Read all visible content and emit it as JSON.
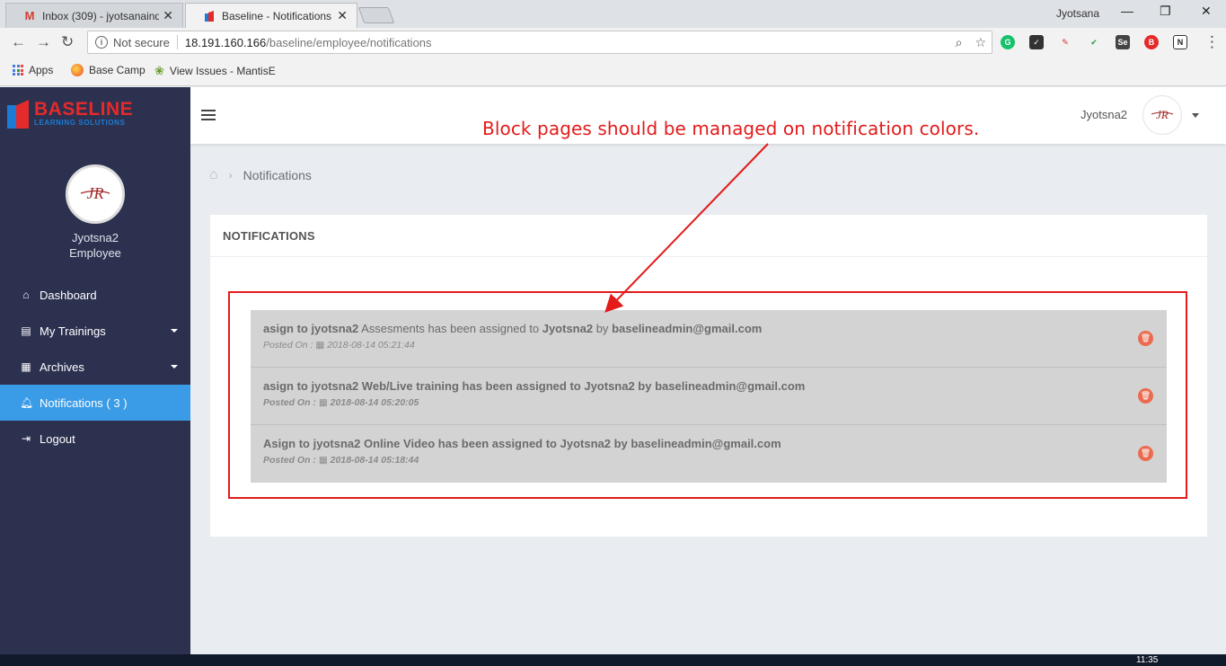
{
  "browser": {
    "tabs": [
      {
        "title": "Inbox (309) - jyotsanaind",
        "active": false
      },
      {
        "title": "Baseline - Notifications",
        "active": true
      }
    ],
    "profile_name": "Jyotsana",
    "url_secure_label": "Not secure",
    "url_host": "18.191.160.166",
    "url_path": "/baseline/employee/notifications",
    "bookmarks": [
      "Apps",
      "Base Camp",
      "View Issues - MantisE"
    ]
  },
  "sidebar": {
    "logo_big": "BASELINE",
    "logo_small": "LEARNING SOLUTIONS",
    "avatar_initials": "JR",
    "user_name": "Jyotsna2",
    "user_role": "Employee",
    "menu": [
      {
        "label": "Dashboard"
      },
      {
        "label": "My Trainings"
      },
      {
        "label": "Archives"
      },
      {
        "label": "Notifications ( 3 )"
      },
      {
        "label": "Logout"
      }
    ]
  },
  "header": {
    "user_name": "Jyotsna2",
    "avatar_initials": "JR"
  },
  "annotation": "Block pages should be managed on notification colors.",
  "breadcrumb": {
    "current": "Notifications"
  },
  "card": {
    "title": "NOTIFICATIONS",
    "notifications": [
      {
        "part1": "asign to jyotsna2",
        "part2": " Assesments has been assigned to ",
        "part3": "Jyotsna2",
        "part4": " by ",
        "part5": "baselineadmin@gmail.com",
        "posted_label": "Posted On :",
        "posted_date": " 2018-08-14 05:21:44"
      },
      {
        "part1": "asign to jyotsna2 Web/Live training has been assigned to Jyotsna2 by baselineadmin@gmail.com",
        "part2": "",
        "part3": "",
        "part4": "",
        "part5": "",
        "posted_label": "Posted On :",
        "posted_date": " 2018-08-14 05:20:05"
      },
      {
        "part1": "Asign to jyotsna2 Online Video has been assigned to Jyotsna2 by baselineadmin@gmail.com",
        "part2": "",
        "part3": "",
        "part4": "",
        "part5": "",
        "posted_label": "Posted On :",
        "posted_date": " 2018-08-14 05:18:44"
      }
    ]
  },
  "taskbar": {
    "clock": "11:35"
  },
  "colors": {
    "sidebar_bg": "#2c3150",
    "active_menu": "#3a9be6",
    "annotation": "#e31b1b",
    "notification_bg": "#d3d3d3",
    "delete_button": "#ea6b50"
  }
}
